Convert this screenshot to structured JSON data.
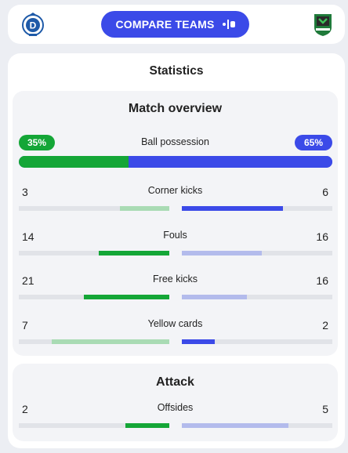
{
  "header": {
    "compare_label": "COMPARE TEAMS",
    "home_logo_icon": "home-club-crest",
    "away_logo_icon": "away-club-crest",
    "compare_icon": "compare-icon"
  },
  "statistics": {
    "title": "Statistics",
    "overview": {
      "title": "Match overview",
      "possession": {
        "label": "Ball possession",
        "home_text": "35%",
        "away_text": "65%",
        "home_pct": 35,
        "away_pct": 65
      },
      "stats": [
        {
          "label": "Corner kicks",
          "home": "3",
          "away": "6",
          "home_frac": 0.33,
          "away_frac": 0.67,
          "home_strong": false,
          "away_strong": true
        },
        {
          "label": "Fouls",
          "home": "14",
          "away": "16",
          "home_frac": 0.47,
          "away_frac": 0.53,
          "home_strong": true,
          "away_strong": false
        },
        {
          "label": "Free kicks",
          "home": "21",
          "away": "16",
          "home_frac": 0.57,
          "away_frac": 0.43,
          "home_strong": true,
          "away_strong": false
        },
        {
          "label": "Yellow cards",
          "home": "7",
          "away": "2",
          "home_frac": 0.78,
          "away_frac": 0.22,
          "home_strong": false,
          "away_strong": true
        }
      ]
    },
    "attack": {
      "title": "Attack",
      "stats": [
        {
          "label": "Offsides",
          "home": "2",
          "away": "5",
          "home_frac": 0.29,
          "away_frac": 0.71,
          "home_strong": true,
          "away_strong": false
        }
      ]
    }
  },
  "colors": {
    "home_strong": "#14a637",
    "home_weak": "#a9dbb4",
    "away_strong": "#3b4ae8",
    "away_weak": "#b3bbec",
    "track": "#e1e3e8"
  }
}
